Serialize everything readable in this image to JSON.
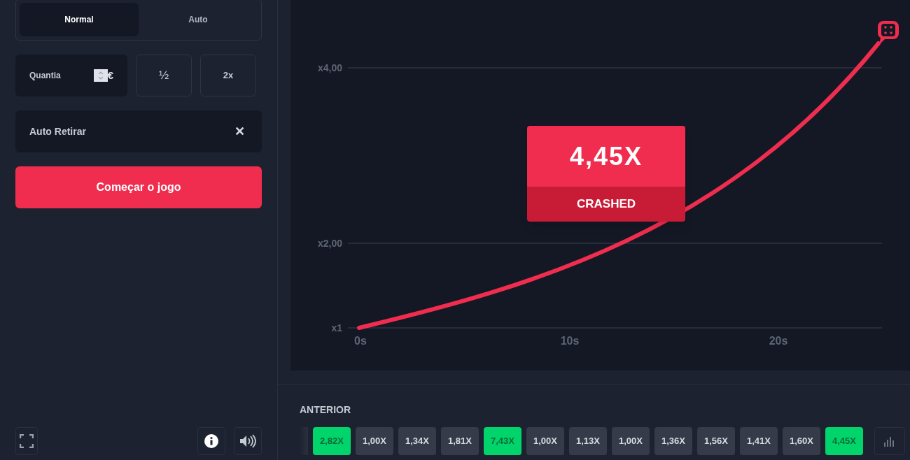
{
  "mode_tabs": [
    {
      "label": "Normal",
      "selected": true
    },
    {
      "label": "Auto",
      "selected": false
    }
  ],
  "amount": {
    "label": "Quantia",
    "currency": "€"
  },
  "half_button": "½",
  "double_button": "2x",
  "auto_cashout": {
    "label": "Auto Retirar",
    "clear": "✕"
  },
  "start_button": "Começar o jogo",
  "chart": {
    "y_labels": [
      "x4,00",
      "x2,00",
      "x1"
    ],
    "x_labels": [
      "0s",
      "10s",
      "20s"
    ]
  },
  "result": {
    "multiplier": "4,45X",
    "status": "CRASHED"
  },
  "history": {
    "title": "ANTERIOR",
    "items": [
      {
        "value": "2,82X",
        "color": "#00d46a"
      },
      {
        "value": "1,00X",
        "color": "#363b49"
      },
      {
        "value": "1,34X",
        "color": "#363b49"
      },
      {
        "value": "1,81X",
        "color": "#363b49"
      },
      {
        "value": "7,43X",
        "color": "#00d46a"
      },
      {
        "value": "1,00X",
        "color": "#363b49"
      },
      {
        "value": "1,13X",
        "color": "#363b49"
      },
      {
        "value": "1,00X",
        "color": "#363b49"
      },
      {
        "value": "1,36X",
        "color": "#363b49"
      },
      {
        "value": "1,56X",
        "color": "#363b49"
      },
      {
        "value": "1,41X",
        "color": "#363b49"
      },
      {
        "value": "1,60X",
        "color": "#363b49"
      },
      {
        "value": "4,45X",
        "color": "#00d46a"
      }
    ]
  }
}
